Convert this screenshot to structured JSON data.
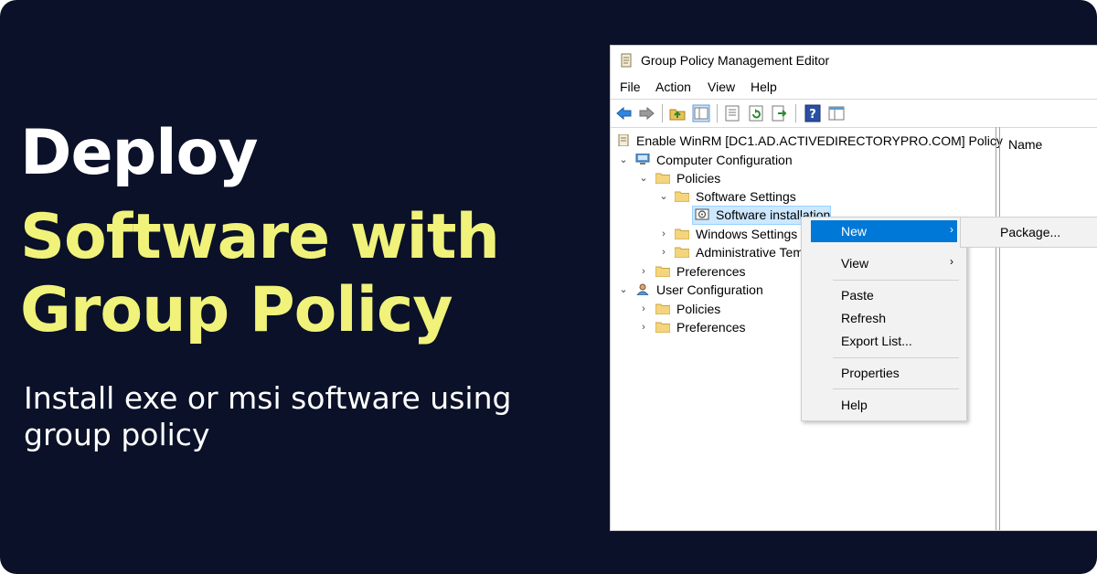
{
  "headline": {
    "line1": "Deploy",
    "line2": "Software with",
    "line3": "Group Policy",
    "subtitle_line1": "Install exe or msi software using",
    "subtitle_line2": "group policy",
    "colors": {
      "background": "#0a1128",
      "white": "#ffffff",
      "accent": "#f0f27a"
    }
  },
  "window": {
    "title": "Group Policy Management Editor",
    "menu": [
      "File",
      "Action",
      "View",
      "Help"
    ],
    "toolbar_icons": [
      "back-arrow-icon",
      "forward-arrow-icon",
      "up-folder-icon",
      "show-hide-tree-icon",
      "properties-icon",
      "refresh-icon",
      "export-list-icon",
      "help-icon",
      "console-tree-icon"
    ],
    "tree": [
      {
        "label": "Enable WinRM [DC1.AD.ACTIVEDIRECTORYPRO.COM] Policy",
        "icon": "policy-scroll-icon"
      },
      {
        "label": "Computer Configuration",
        "icon": "computer-icon",
        "expanded": true
      },
      {
        "label": "Policies",
        "icon": "folder-icon",
        "expanded": true
      },
      {
        "label": "Software Settings",
        "icon": "folder-icon",
        "expanded": true
      },
      {
        "label": "Software installation",
        "icon": "software-installation-icon",
        "selected": true
      },
      {
        "label": "Windows Settings",
        "icon": "folder-icon",
        "expanded": false
      },
      {
        "label": "Administrative Tem",
        "icon": "folder-icon",
        "expanded": false
      },
      {
        "label": "Preferences",
        "icon": "folder-icon",
        "expanded": false
      },
      {
        "label": "User Configuration",
        "icon": "user-icon",
        "expanded": true
      },
      {
        "label": "Policies",
        "icon": "folder-icon",
        "expanded": false
      },
      {
        "label": "Preferences",
        "icon": "folder-icon",
        "expanded": false
      }
    ],
    "right_pane": {
      "column_header": "Name"
    }
  },
  "context_menu": {
    "items": [
      {
        "label": "New",
        "has_submenu": true,
        "highlighted": true
      },
      {
        "label": "View",
        "has_submenu": true
      },
      {
        "label": "Paste"
      },
      {
        "label": "Refresh"
      },
      {
        "label": "Export List..."
      },
      {
        "label": "Properties"
      },
      {
        "label": "Help"
      }
    ],
    "submenu": {
      "label": "Package..."
    },
    "colors": {
      "highlight": "#0078d7"
    }
  }
}
